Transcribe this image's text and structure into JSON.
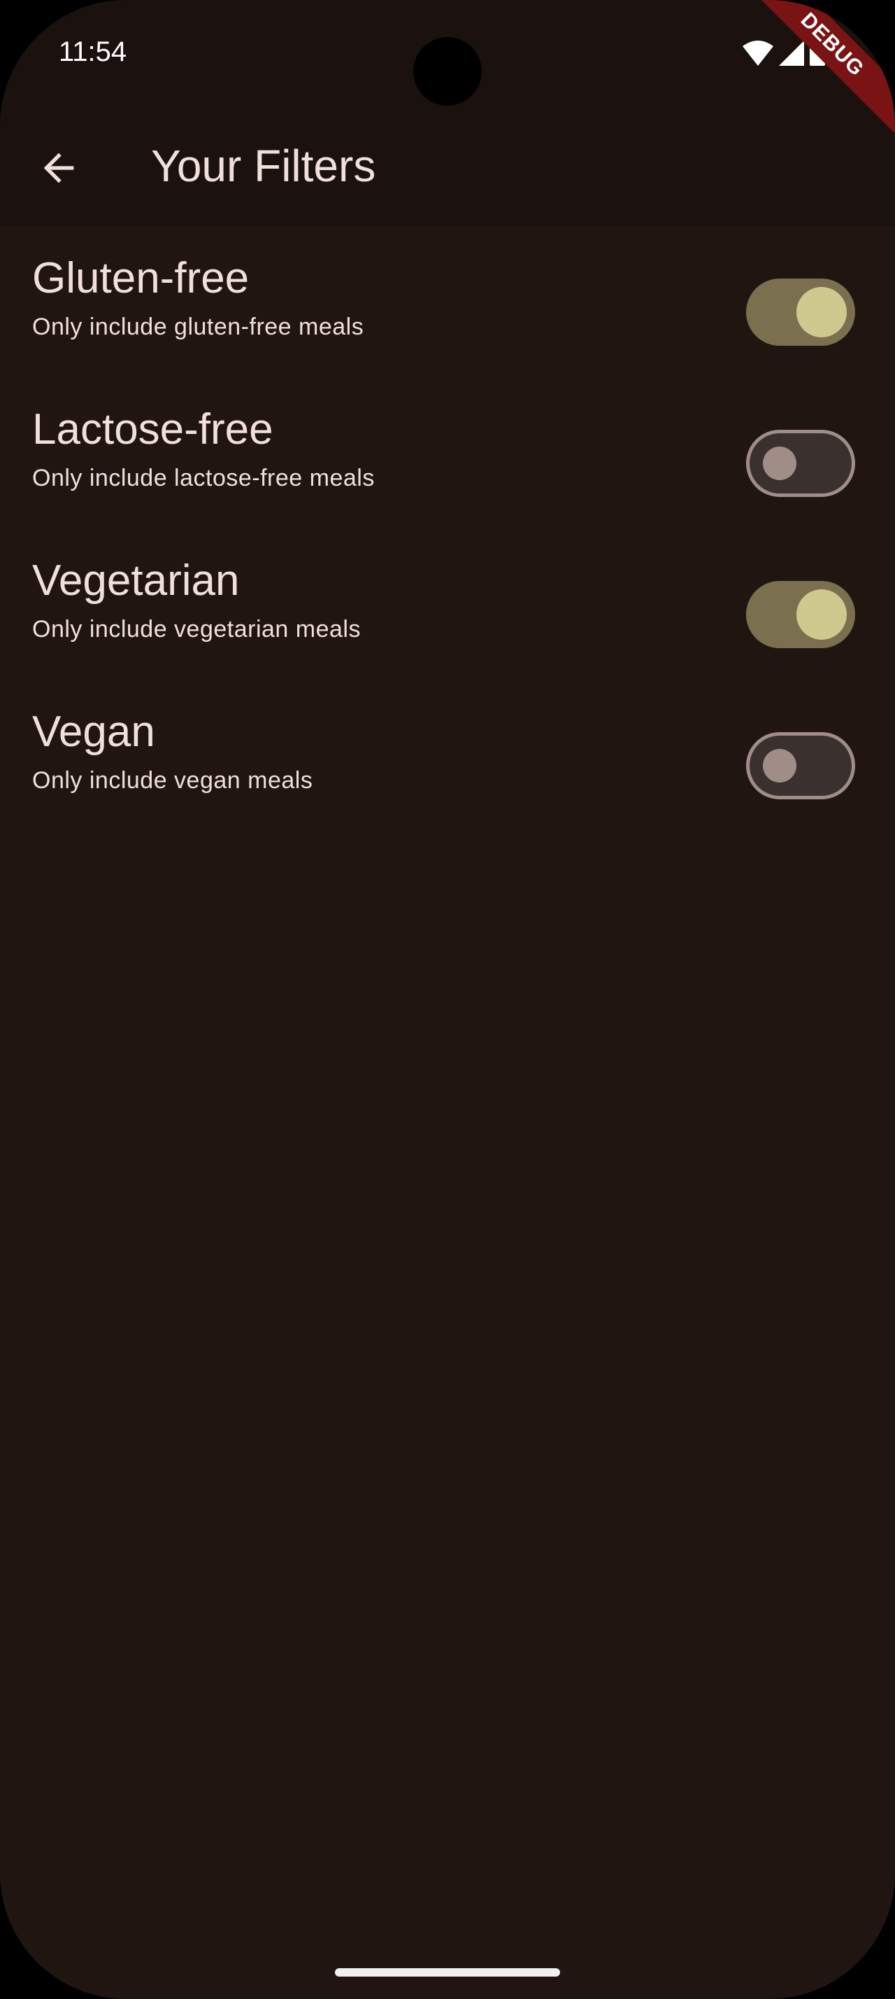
{
  "status_bar": {
    "time": "11:54",
    "debug_banner": "DEBUG"
  },
  "app_bar": {
    "title": "Your Filters",
    "back_icon": "arrow-back-icon"
  },
  "filters": [
    {
      "title": "Gluten-free",
      "subtitle": "Only include gluten-free meals",
      "enabled": true
    },
    {
      "title": "Lactose-free",
      "subtitle": "Only include lactose-free meals",
      "enabled": false
    },
    {
      "title": "Vegetarian",
      "subtitle": "Only include vegetarian meals",
      "enabled": true
    },
    {
      "title": "Vegan",
      "subtitle": "Only include vegan meals",
      "enabled": false
    }
  ],
  "colors": {
    "background": "#211512",
    "app_bar": "#1b1210",
    "text": "#f0dfda",
    "switch_on_track": "#7a7050",
    "switch_on_thumb": "#d0c98f",
    "switch_off_border": "#a08d88"
  }
}
